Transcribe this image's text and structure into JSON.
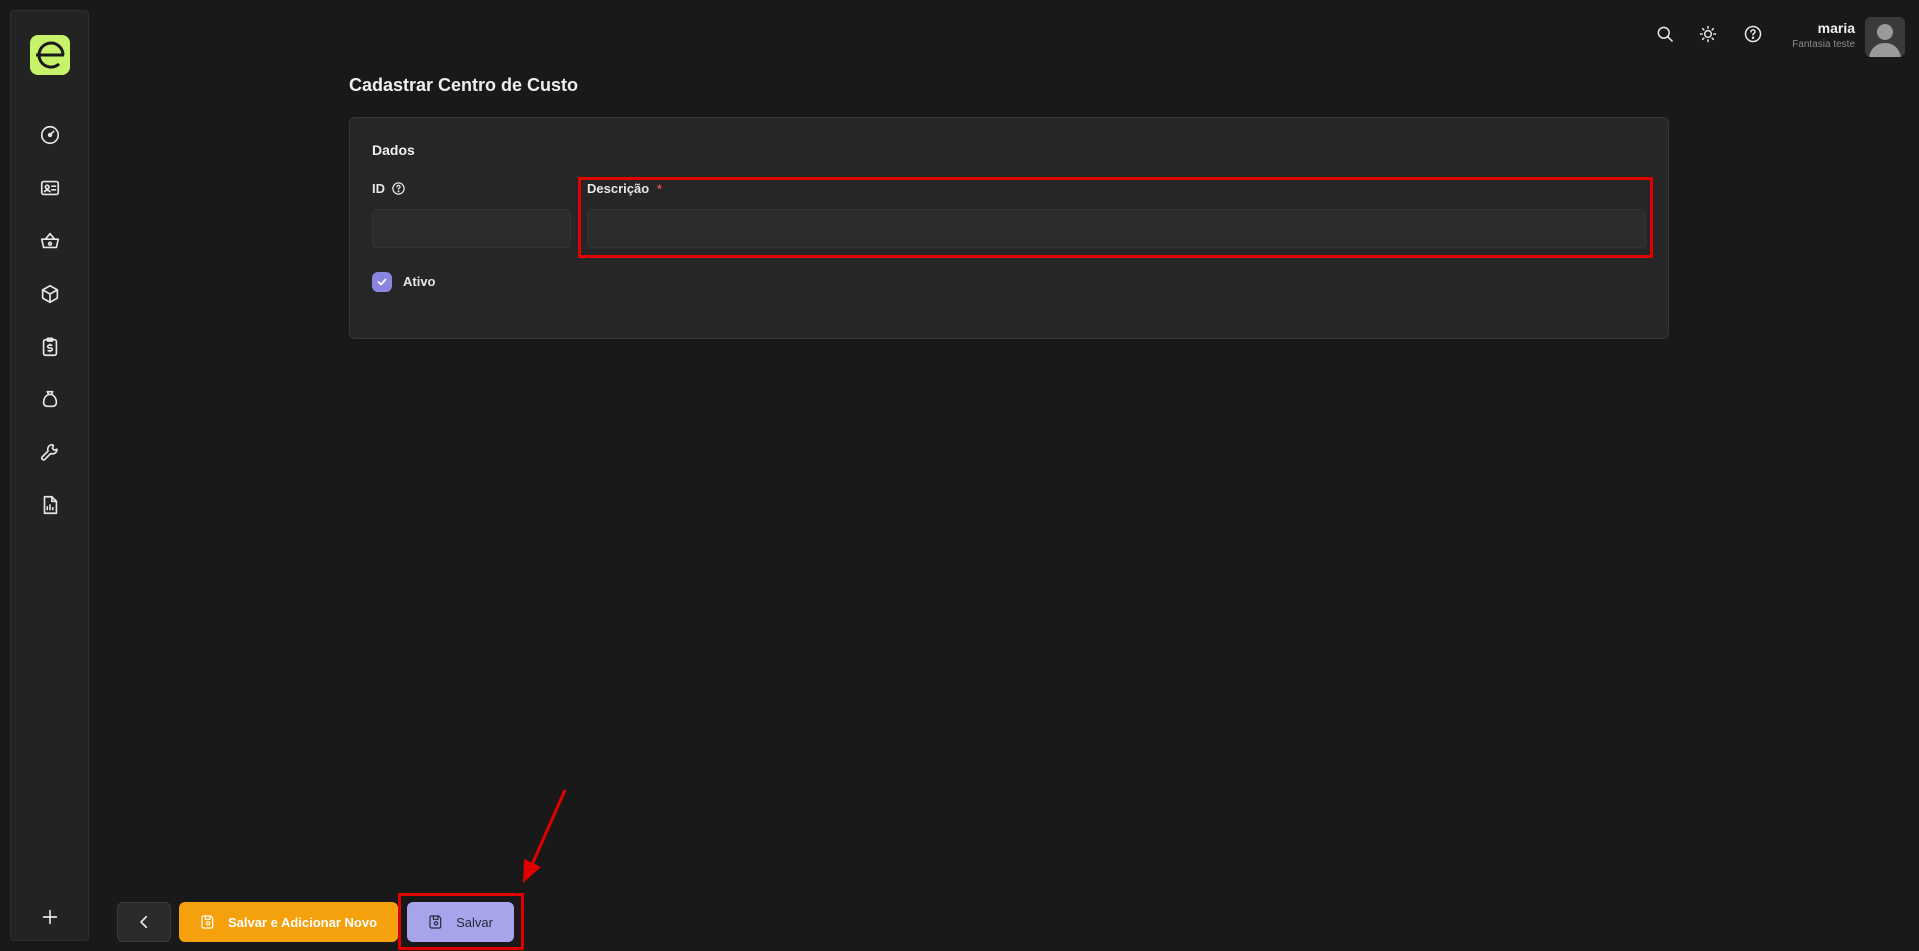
{
  "sidebar": {
    "logo_letter": "e",
    "items": [
      {
        "name": "dashboard",
        "icon": "gauge-icon"
      },
      {
        "name": "contacts",
        "icon": "id-card-icon"
      },
      {
        "name": "sales",
        "icon": "basket-icon"
      },
      {
        "name": "products",
        "icon": "box-icon"
      },
      {
        "name": "financial",
        "icon": "clipboard-dollar-icon"
      },
      {
        "name": "money",
        "icon": "money-bag-icon"
      },
      {
        "name": "tools",
        "icon": "wrench-icon"
      },
      {
        "name": "reports",
        "icon": "report-icon"
      }
    ],
    "add_icon": "plus-icon"
  },
  "topbar": {
    "user_name": "maria",
    "user_company": "Fantasia teste"
  },
  "page": {
    "title": "Cadastrar Centro de Custo"
  },
  "form": {
    "section_title": "Dados",
    "id_label": "ID",
    "id_value": "",
    "description_label": "Descrição",
    "description_required": "*",
    "description_value": "",
    "active_label": "Ativo",
    "active_checked": true
  },
  "actions": {
    "save_new_label": "Salvar e Adicionar Novo",
    "save_label": "Salvar"
  },
  "colors": {
    "accent_green": "#c6f36a",
    "save_new_orange": "#f5a10e",
    "save_purple": "#a7a4ec",
    "checkbox_purple": "#8a86e0",
    "annotation_red": "#e00000"
  }
}
